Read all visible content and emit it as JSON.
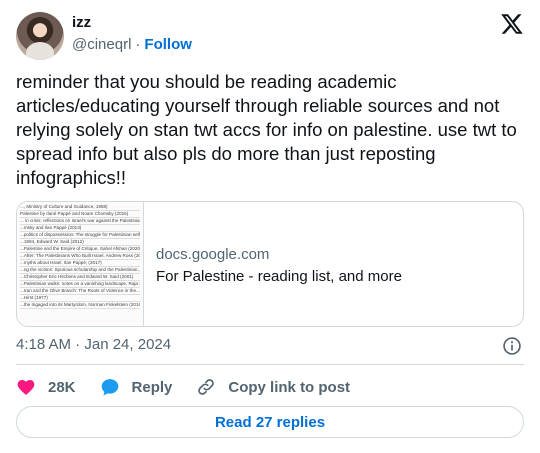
{
  "author": {
    "name": "izz",
    "handle": "@cineqrl",
    "separator": "·",
    "follow_label": "Follow"
  },
  "tweet": {
    "text": "reminder that you should be reading academic articles/educating yourself through reliable sources and not relying solely on stan twt accs for info on palestine. use twt to spread info but also pls do more than just reposting infographics!!",
    "timestamp": "4:18 AM · Jan 24, 2024"
  },
  "card": {
    "domain": "docs.google.com",
    "title": "For Palestine - reading list, and more",
    "thumbnail_lines": [
      "..., Ministry of Culture and Guidance, 1968)",
      "Palestine by Ilané Pappé and Noam Chomsky (2015)",
      "... in crisis: reflections on Israel's war against the Palestinians",
      "...msky and Ilan Pappé (2013)",
      "...politics of dispossession: The struggle for Palestinian self-d...",
      "...1994, Edward W. Said (2012)",
      "...Palestine and the Empire of Critique, Sahel Afshan (2020)",
      "...After: The Palestinians Who Built Israel, Andrew Ross (2019)",
      "...myths about Israel, Ilan Pappé, (2017)",
      "...ng the victims: Spurious scholarship and the Palestinian...",
      "...Christopher Eric Hitchens and Edward W. Said (2001)",
      "...Palestinian walks: notes on a vanishing landscape, Raja Shehadeh",
      "...Iran and the Olive Branch: The Roots of Violence in the...",
      "...Hirst (1977)",
      "...the Ingaged into its Martyrdom, Norman Finkelstein (2016)"
    ]
  },
  "actions": {
    "like_count": "28K",
    "reply_label": "Reply",
    "copy_label": "Copy link to post",
    "read_replies_label": "Read 27 replies"
  },
  "colors": {
    "accent": "#006fd6",
    "like": "#f91880",
    "reply": "#1d9bf0",
    "muted": "#536471",
    "border": "#cfd9de"
  },
  "icons": [
    "x-logo-icon",
    "info-icon",
    "heart-icon",
    "reply-bubble-icon",
    "link-icon"
  ]
}
